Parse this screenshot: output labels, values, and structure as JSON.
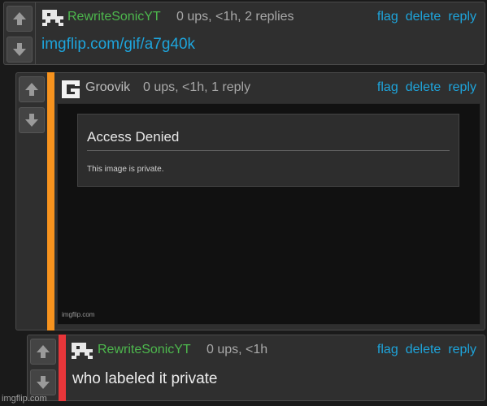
{
  "comments": [
    {
      "username": "RewriteSonicYT",
      "meta": "0 ups, <1h, 2 replies",
      "body": "imgflip.com/gif/a7g40k",
      "actions": {
        "flag": "flag",
        "delete": "delete",
        "reply": "reply"
      },
      "bar_color": "#2f2f2f"
    },
    {
      "username": "Groovik",
      "meta": "0 ups, <1h, 1 reply",
      "actions": {
        "flag": "flag",
        "delete": "delete",
        "reply": "reply"
      },
      "bar_color": "#f7931e",
      "embed": {
        "dialog_title": "Access Denied",
        "dialog_message": "This image is private.",
        "watermark": "imgflip.com"
      }
    },
    {
      "username": "RewriteSonicYT",
      "meta": "0 ups, <1h",
      "body": "who labeled it private",
      "actions": {
        "flag": "flag",
        "delete": "delete",
        "reply": "reply"
      },
      "bar_color": "#e8363a"
    }
  ],
  "icons": {
    "upvote": "arrow-up-icon",
    "downvote": "arrow-down-icon",
    "avatar_pixel": "pixel-avatar-icon",
    "avatar_g": "g-logo-avatar-icon"
  },
  "colors": {
    "background": "#1a1a1a",
    "panel": "#2f2f2f",
    "link": "#1ea4db",
    "username_green": "#4db84d"
  },
  "watermark": "imgflip.com"
}
